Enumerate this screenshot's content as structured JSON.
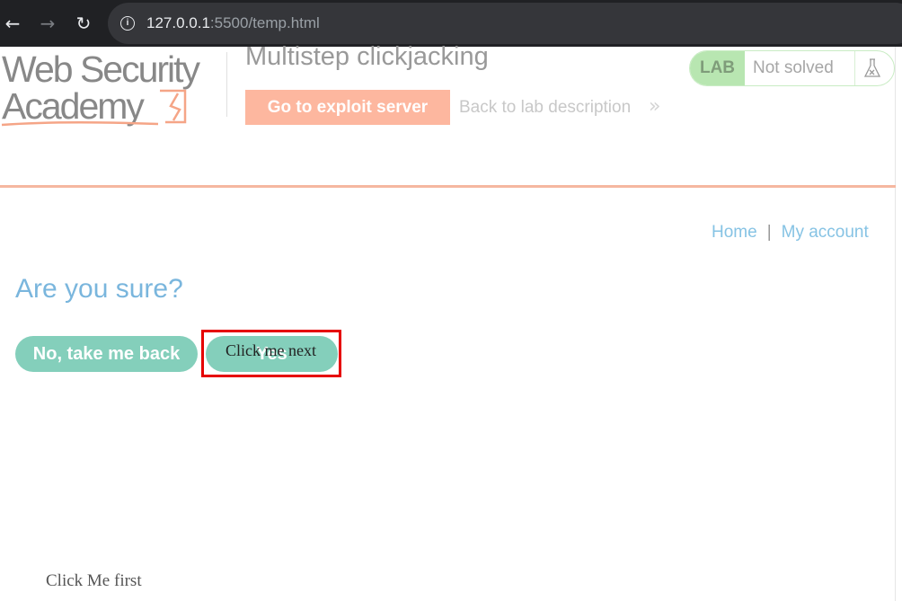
{
  "browser": {
    "back_icon": "←",
    "forward_icon": "→",
    "reload_icon": "↻",
    "info_icon": "i",
    "url_host": "127.0.0.1",
    "url_rest": ":5500/temp.html"
  },
  "header": {
    "logo_line1": "Web Security",
    "logo_line2": "Academy",
    "lab_title": "Multistep clickjacking",
    "exploit_button": "Go to exploit server",
    "back_link": "Back to lab description",
    "back_chevron": "»",
    "lab_badge": "LAB",
    "lab_status": "Not solved"
  },
  "nav": {
    "home": "Home",
    "separator": "|",
    "account": "My account"
  },
  "main": {
    "heading": "Are you sure?",
    "no_button": "No, take me back",
    "yes_button": "Yes"
  },
  "decoy": {
    "click_next": "Click me next",
    "click_first": "Click Me first"
  },
  "colors": {
    "accent_orange": "#fdab8f",
    "accent_teal": "#84cfbb",
    "link_blue": "#86c3e4",
    "decoy_border": "#e60000"
  }
}
